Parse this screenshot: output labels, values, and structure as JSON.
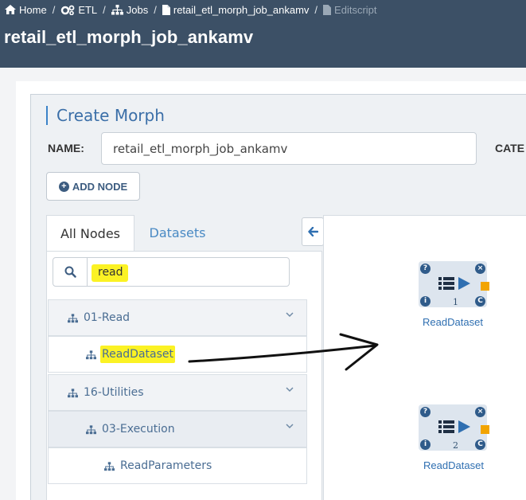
{
  "breadcrumb": {
    "home": "Home",
    "etl": "ETL",
    "jobs": "Jobs",
    "job": "retail_etl_morph_job_ankamv",
    "current": "Editscript",
    "separator": "/"
  },
  "page_title": "retail_etl_morph_job_ankamv",
  "form": {
    "section_title": "Create Morph",
    "name_label": "NAME:",
    "name_value": "retail_etl_morph_job_ankamv",
    "category_label": "CATE",
    "add_node_label": "ADD NODE"
  },
  "palette": {
    "tabs": [
      {
        "label": "All Nodes",
        "active": true
      },
      {
        "label": "Datasets",
        "active": false
      }
    ],
    "search_value": "read",
    "tree": {
      "group1": {
        "label": "01-Read"
      },
      "group1_item": {
        "label": "ReadDataset",
        "highlighted": true
      },
      "group2": {
        "label": "16-Utilities"
      },
      "group2_sub": {
        "label": "03-Execution"
      },
      "group2_sub_item": {
        "label": "ReadParameters"
      }
    }
  },
  "canvas": {
    "nodes": [
      {
        "label": "ReadDataset",
        "number": "1"
      },
      {
        "label": "ReadDataset",
        "number": "2"
      }
    ],
    "badges": {
      "help": "?",
      "close": "×",
      "info": "i",
      "config": "C"
    }
  },
  "colors": {
    "header_bg": "#3c5066",
    "accent": "#3b83c8",
    "highlight": "#fbf224",
    "node_bg": "#dde5ee",
    "node_output": "#f2a400"
  }
}
